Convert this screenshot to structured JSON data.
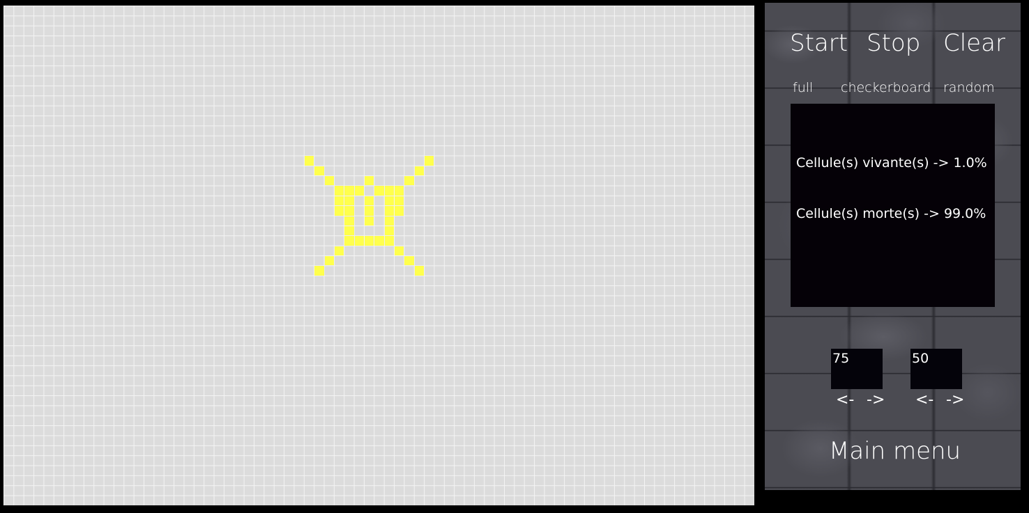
{
  "controls": {
    "start_label": "Start",
    "stop_label": "Stop",
    "clear_label": "Clear",
    "pattern_full": "full",
    "pattern_checkerboard": "checkerboard",
    "pattern_random": "random"
  },
  "stats": {
    "alive_text": "Cellule(s) vivante(s) -> 1.0%",
    "dead_text": "Cellule(s) morte(s) -> 99.0%"
  },
  "size": {
    "width_value": "75",
    "height_value": "50",
    "left_arrow": "<-",
    "right_arrow": "->"
  },
  "main_menu_label": "Main menu",
  "colors": {
    "alive_cell": "#ffff4d",
    "grid_bg": "#dcdcdc",
    "stats_bg": "#050107"
  },
  "grid": {
    "columns": 75,
    "rows": 50,
    "alive_cells": [
      [
        30,
        15
      ],
      [
        42,
        15
      ],
      [
        31,
        16
      ],
      [
        41,
        16
      ],
      [
        32,
        17
      ],
      [
        36,
        17
      ],
      [
        40,
        17
      ],
      [
        33,
        18
      ],
      [
        34,
        18
      ],
      [
        35,
        18
      ],
      [
        37,
        18
      ],
      [
        38,
        18
      ],
      [
        39,
        18
      ],
      [
        33,
        19
      ],
      [
        34,
        19
      ],
      [
        36,
        19
      ],
      [
        38,
        19
      ],
      [
        39,
        19
      ],
      [
        33,
        20
      ],
      [
        34,
        20
      ],
      [
        36,
        20
      ],
      [
        38,
        20
      ],
      [
        39,
        20
      ],
      [
        34,
        21
      ],
      [
        36,
        21
      ],
      [
        38,
        21
      ],
      [
        34,
        22
      ],
      [
        38,
        22
      ],
      [
        34,
        23
      ],
      [
        35,
        23
      ],
      [
        36,
        23
      ],
      [
        37,
        23
      ],
      [
        38,
        23
      ],
      [
        33,
        24
      ],
      [
        39,
        24
      ],
      [
        32,
        25
      ],
      [
        40,
        25
      ],
      [
        31,
        26
      ],
      [
        41,
        26
      ]
    ]
  }
}
